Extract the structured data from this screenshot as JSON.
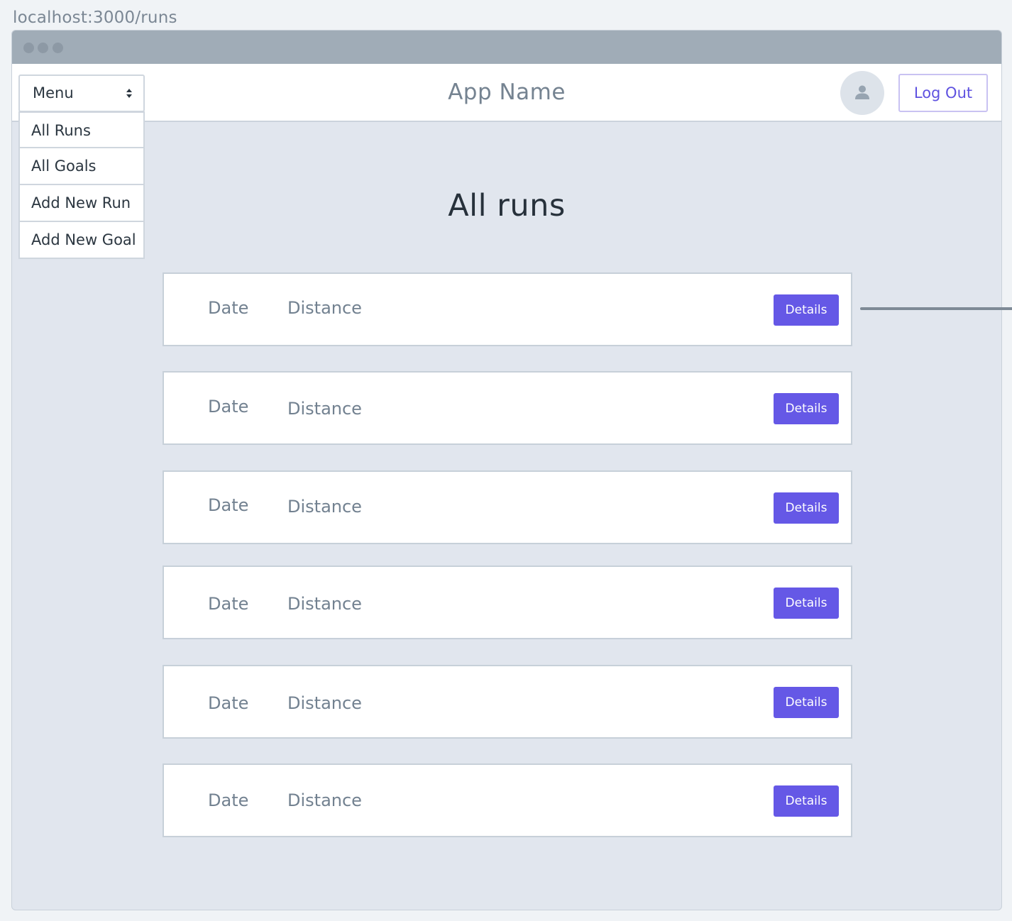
{
  "browser": {
    "url": "localhost:3000/runs"
  },
  "header": {
    "app_name": "App Name",
    "logout_label": "Log Out"
  },
  "menu": {
    "selected": "Menu",
    "items": [
      {
        "label": "All Runs"
      },
      {
        "label": "All Goals"
      },
      {
        "label": "Add New Run"
      },
      {
        "label": "Add New Goal"
      }
    ]
  },
  "main": {
    "title": "All runs",
    "runs": [
      {
        "date": "Date",
        "distance": "Distance",
        "button": "Details"
      },
      {
        "date": "Date",
        "distance": "Distance",
        "button": "Details"
      },
      {
        "date": "Date",
        "distance": "Distance",
        "button": "Details"
      },
      {
        "date": "Date",
        "distance": "Distance",
        "button": "Details"
      },
      {
        "date": "Date",
        "distance": "Distance",
        "button": "Details"
      },
      {
        "date": "Date",
        "distance": "Distance",
        "button": "Details"
      }
    ]
  },
  "colors": {
    "accent": "#6558e6",
    "background": "#e1e6ee",
    "titlebar": "#a0acb7"
  }
}
